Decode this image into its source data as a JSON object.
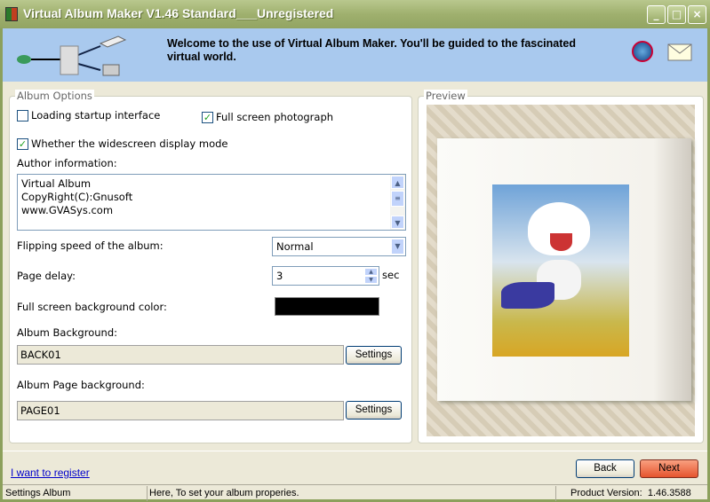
{
  "window": {
    "title": "Virtual Album Maker V1.46 Standard___Unregistered"
  },
  "header": {
    "welcome": "Welcome to the use of Virtual Album Maker. You'll be guided to the fascinated virtual world."
  },
  "options": {
    "group_label": "Album Options",
    "loading_startup": {
      "label": "Loading startup interface",
      "checked": false
    },
    "full_screen_photo": {
      "label": "Full screen photograph",
      "checked": true
    },
    "widescreen": {
      "label": "Whether the widescreen display mode",
      "checked": true
    },
    "author_label": "Author information:",
    "author_lines": [
      "Virtual Album",
      "CopyRight(C):Gnusoft",
      "www.GVASys.com"
    ],
    "flip_label": "Flipping speed of the album:",
    "flip_value": "Normal",
    "delay_label": "Page delay:",
    "delay_value": "3",
    "delay_unit": "sec",
    "bg_color_label": "Full screen background color:",
    "bg_color": "#000000",
    "album_bg_label": "Album Background:",
    "album_bg_value": "BACK01",
    "page_bg_label": "Album Page background:",
    "page_bg_value": "PAGE01",
    "settings_label": "Settings"
  },
  "preview": {
    "group_label": "Preview"
  },
  "footer": {
    "register_link": "I want to register",
    "back": "Back",
    "next": "Next"
  },
  "status": {
    "section": "Settings Album",
    "message": "Here, To set your album properies.",
    "version": "Product Version:  1.46.3588"
  }
}
